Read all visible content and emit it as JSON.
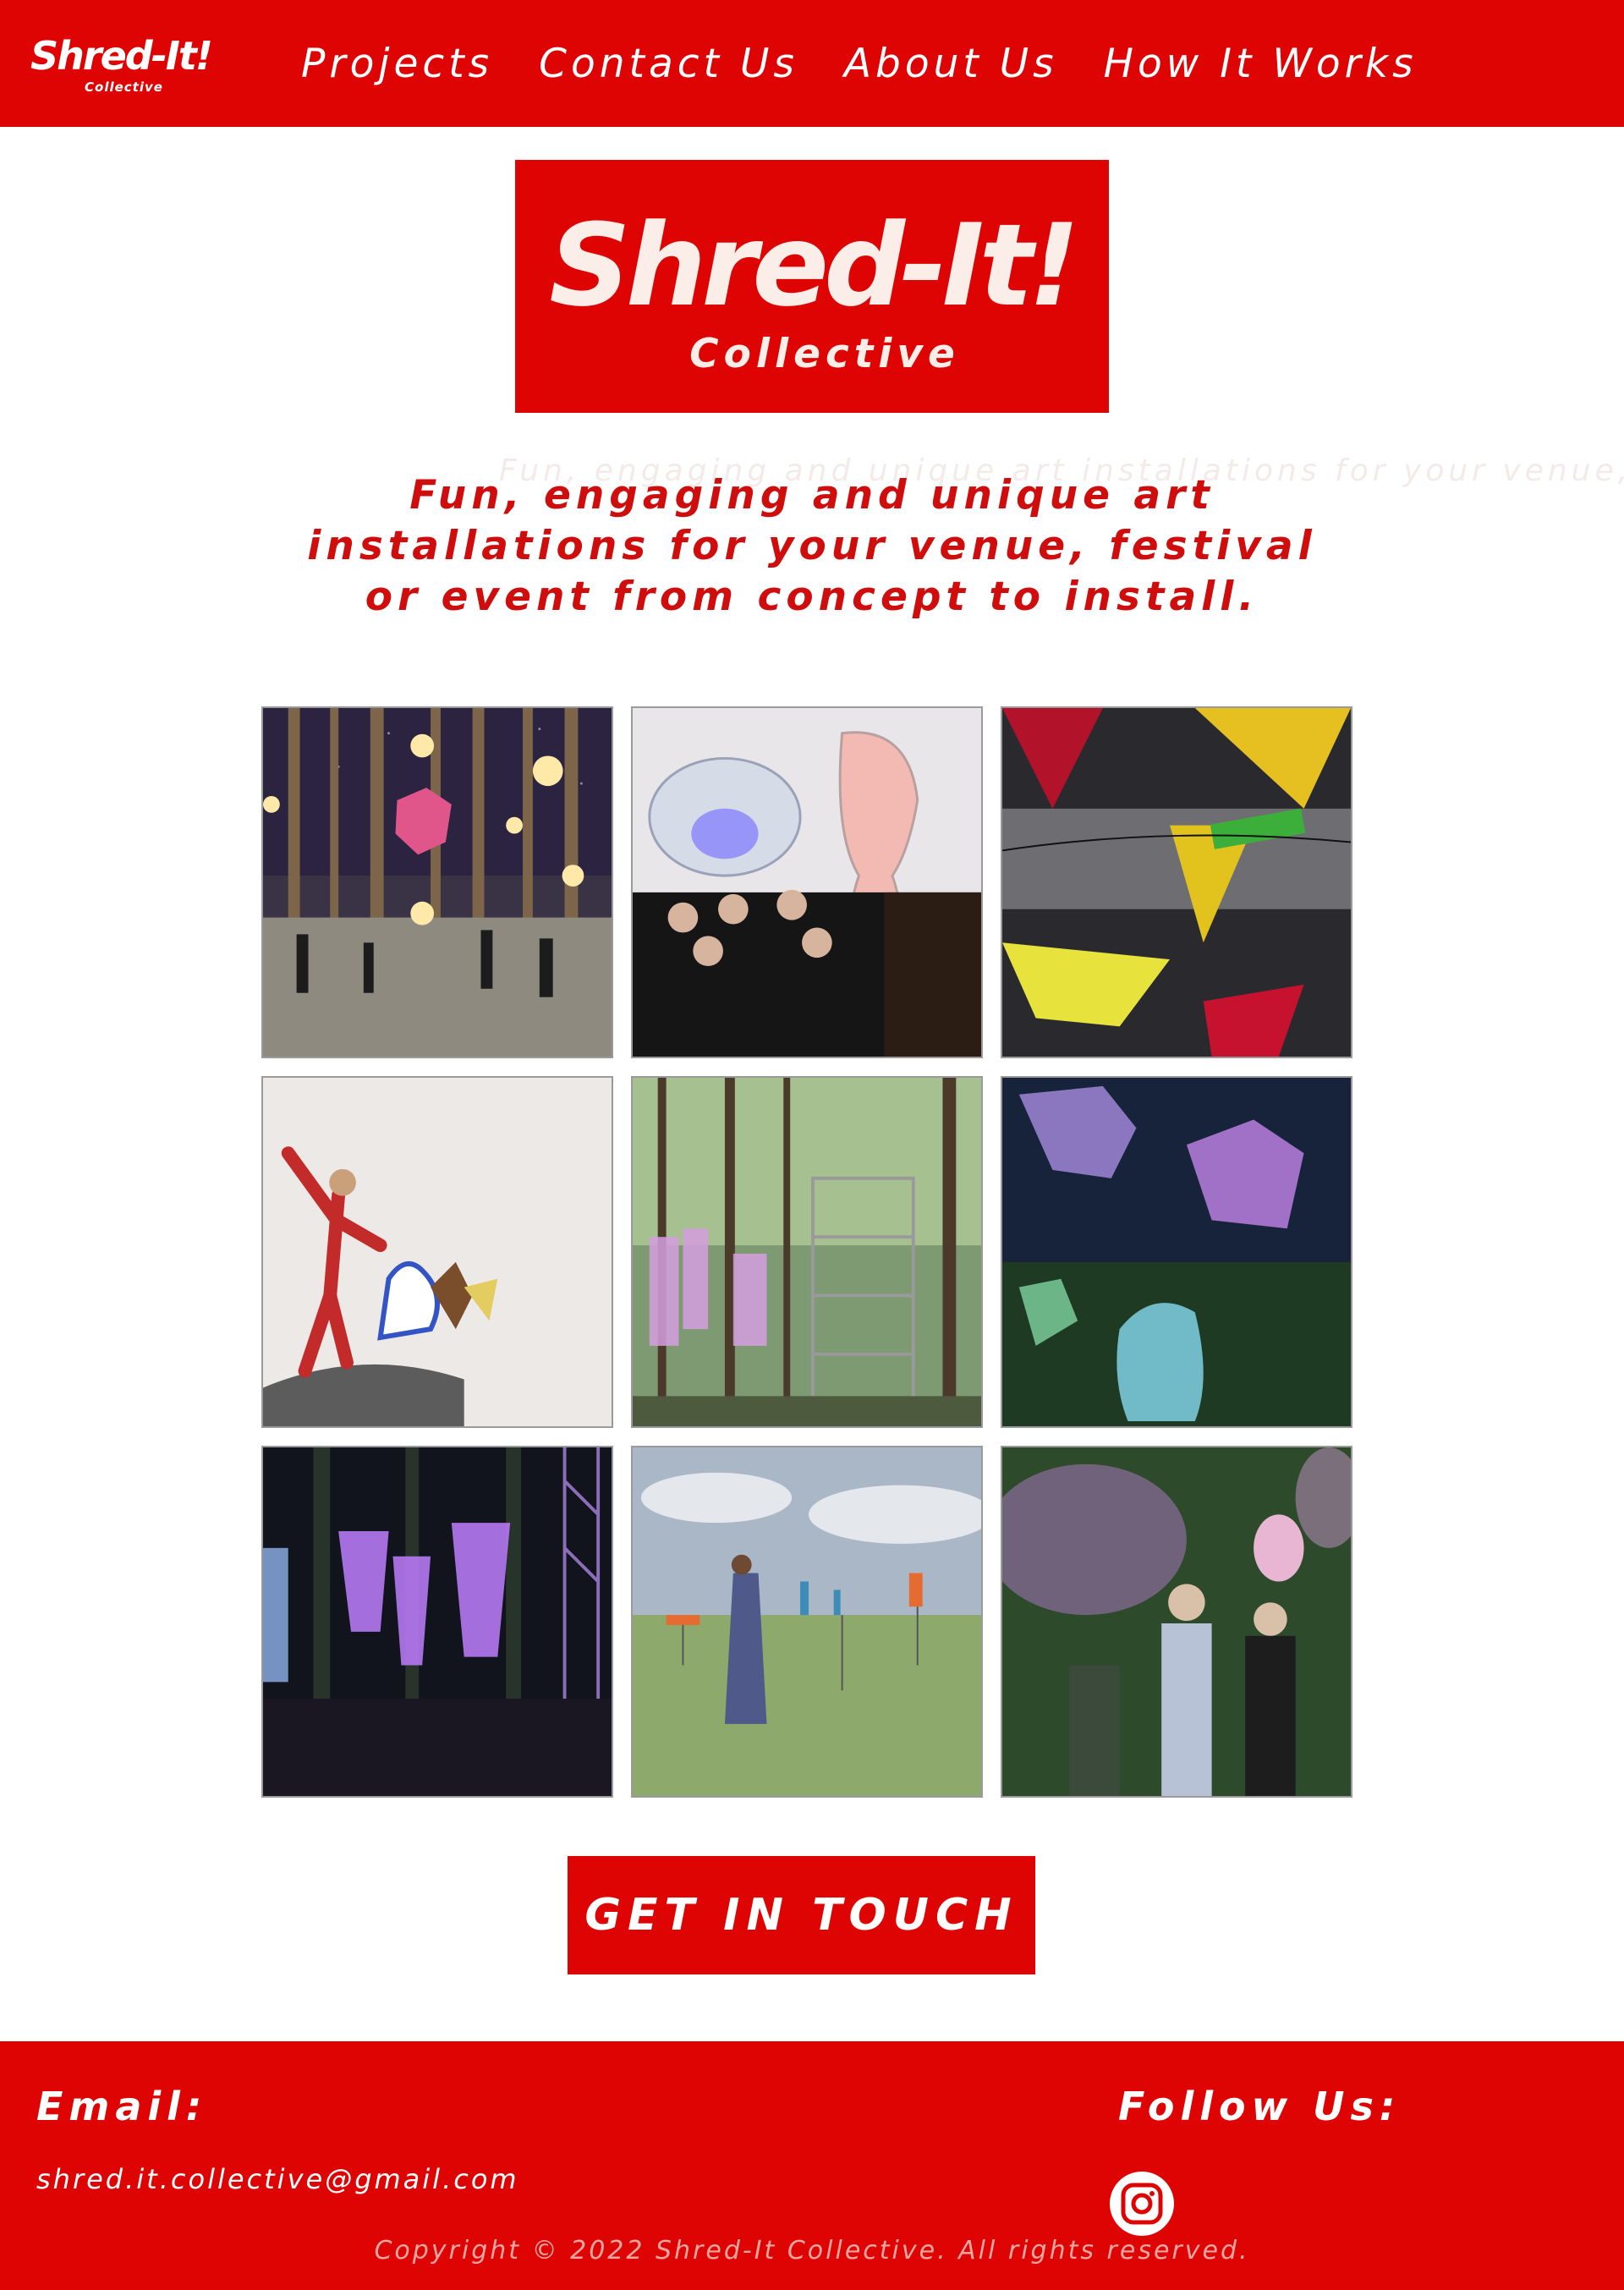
{
  "header": {
    "logo_main": "Shred-It!",
    "logo_sub": "Collective",
    "nav": [
      {
        "label": "Projects"
      },
      {
        "label": "Contact Us"
      },
      {
        "label": "About Us"
      },
      {
        "label": "How It Works"
      }
    ]
  },
  "hero": {
    "logo_main": "Shred-It!",
    "logo_sub": "Collective",
    "tagline_ghost": "Fun, engaging and unique art installations for your venue, f",
    "tagline_lines": [
      "Fun, engaging and unique art",
      "installations for your venue, festival",
      "or event  from concept to install."
    ]
  },
  "gallery": {
    "items": [
      {
        "subject": "forest-performers-with-glowing-shapes-photo"
      },
      {
        "subject": "choir-under-lit-sculptures-photo"
      },
      {
        "subject": "colorful-triangle-flags-collage-photo"
      },
      {
        "subject": "dancing-figure-cutouts-photo"
      },
      {
        "subject": "forest-lanterns-and-scaffold-photo"
      },
      {
        "subject": "glowing-canopy-at-night-photo"
      },
      {
        "subject": "purple-lanterns-concert-photo"
      },
      {
        "subject": "field-installation-render-photo"
      },
      {
        "subject": "visitors-under-pink-sculptures-photo"
      }
    ]
  },
  "cta": {
    "label": "GET IN TOUCH"
  },
  "footer": {
    "email_heading": "Email:",
    "email": "shred.it.collective@gmail.com",
    "follow_heading": "Follow Us:",
    "social_icon": "instagram-icon",
    "copyright": "Copyright © 2022 Shred-It Collective. All rights reserved."
  },
  "colors": {
    "brand_red": "#df0404",
    "tagline_red": "#d00d0d",
    "white": "#ffffff"
  }
}
